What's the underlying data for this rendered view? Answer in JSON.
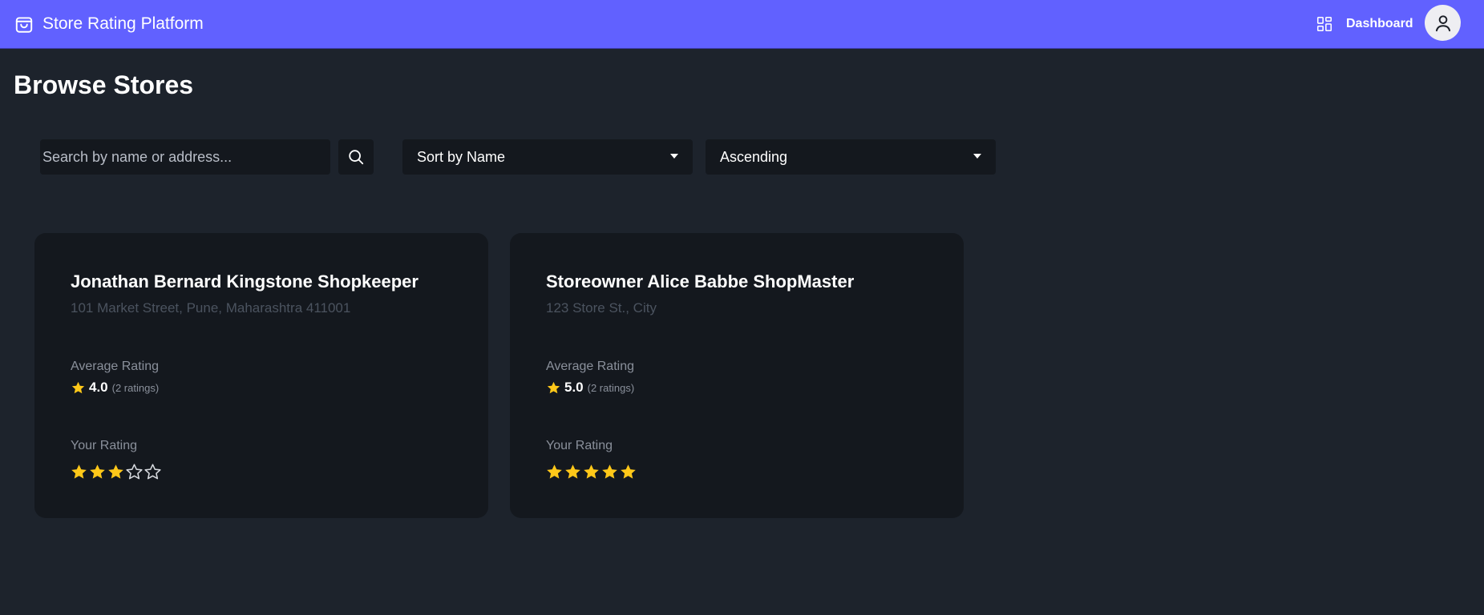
{
  "app": {
    "title": "Store Rating Platform",
    "brand_icon": "shopping-bag-icon",
    "accent_color": "#6161ff"
  },
  "nav": {
    "dashboard_label": "Dashboard",
    "dashboard_icon": "grid-icon",
    "avatar_icon": "user-icon"
  },
  "page": {
    "title": "Browse Stores"
  },
  "filters": {
    "search_placeholder": "Search by name or address...",
    "search_value": "",
    "search_icon": "search-icon",
    "sort_by": "Sort by Name",
    "order": "Ascending"
  },
  "labels": {
    "average_rating": "Average Rating",
    "your_rating": "Your Rating"
  },
  "colors": {
    "star_filled": "#ffc819",
    "star_outline": "#d8dbe0"
  },
  "stores": [
    {
      "name": "Jonathan Bernard Kingstone Shopkeeper",
      "address": "101 Market Street, Pune, Maharashtra 411001",
      "average_rating": "4.0",
      "rating_count": "(2 ratings)",
      "user_rating": 3,
      "max_rating": 5
    },
    {
      "name": "Storeowner Alice Babbe ShopMaster",
      "address": "123 Store St., City",
      "average_rating": "5.0",
      "rating_count": "(2 ratings)",
      "user_rating": 5,
      "max_rating": 5
    }
  ]
}
